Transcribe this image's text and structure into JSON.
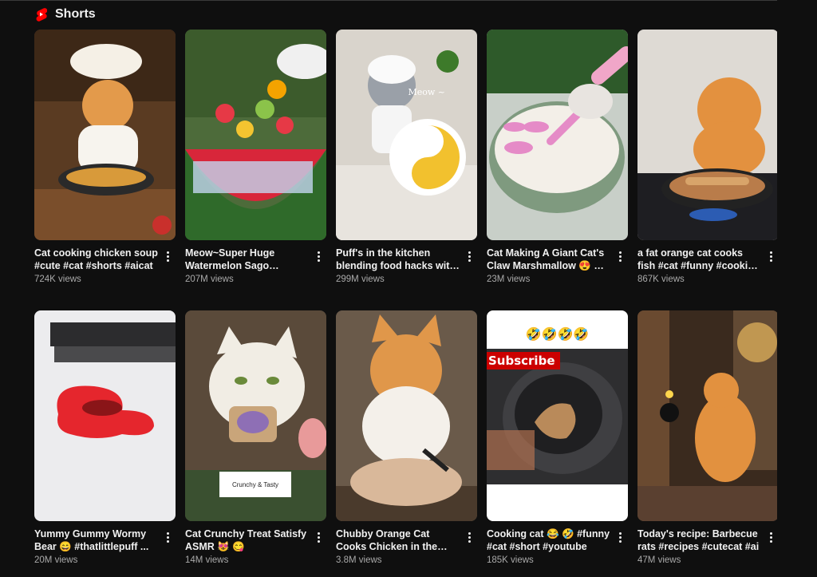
{
  "section": {
    "title": "Shorts"
  },
  "row1": [
    {
      "title": "Cat cooking chicken soup #cute #cat #shorts #aicat",
      "views": "724K views"
    },
    {
      "title": "Meow~Super Huge Watermelon Sago Dessert...",
      "views": "207M views"
    },
    {
      "title": "Puff's in the kitchen blending food hacks with ...",
      "views": "299M views"
    },
    {
      "title": "Cat Making A Giant Cat's Claw Marshmallow 😍 😊 ...",
      "views": "23M views"
    },
    {
      "title": "a fat orange cat cooks fish #cat #funny #cooking #ai ...",
      "views": "867K views"
    }
  ],
  "row2": [
    {
      "title": "Yummy Gummy Wormy Bear 😄 #thatlittlepuff ...",
      "views": "20M views"
    },
    {
      "title": "Cat Crunchy Treat Satisfy ASMR 😻 😋",
      "views": "14M views"
    },
    {
      "title": "Chubby Orange Cat Cooks Chicken in the Cutest Way...",
      "views": "3.8M views"
    },
    {
      "title": "Cooking cat 😂 🤣 #funny #cat #short #youtube",
      "views": "185K views"
    },
    {
      "title": "Today's recipe: Barbecue rats #recipes #cutecat #ai",
      "views": "47M views"
    }
  ],
  "overlays": {
    "meow": "Meow ~",
    "sticker": "Crunchy & Tasty",
    "subscribe": "Subscribe",
    "emojis": "🤣🤣🤣🤣"
  },
  "colors": {
    "background": "#0f0f0f",
    "shorts_red": "#ff0000",
    "meta_gray": "#aaaaaa"
  }
}
